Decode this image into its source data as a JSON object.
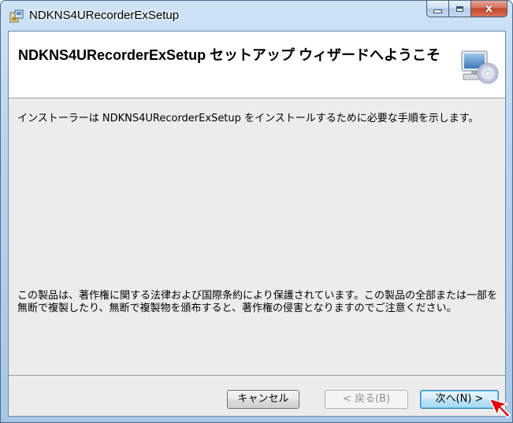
{
  "window": {
    "title": "NDKNS4URecorderExSetup",
    "minimize_icon": "minimize-icon",
    "maximize_icon": "maximize-icon",
    "close_icon": "close-icon",
    "close_glyph": "x"
  },
  "banner": {
    "title": "NDKNS4URecorderExSetup セットアップ ウィザードへようこそ",
    "icon": "installer-computer-cd-icon"
  },
  "body": {
    "intro": "インストーラーは NDKNS4URecorderExSetup をインストールするために必要な手順を示します。",
    "copyright": "この製品は、著作権に関する法律および国際条約により保護されています。この製品の全部または一部を無断で複製したり、無断で複製物を頒布すると、著作権の侵害となりますのでご注意ください。"
  },
  "footer": {
    "cancel_label": "キャンセル",
    "back_label": "< 戻る(B)",
    "next_label": "次へ(N) >"
  },
  "colors": {
    "accent": "#3c7fb1",
    "close_button": "#c2452b",
    "pointer": "#e3000f"
  }
}
